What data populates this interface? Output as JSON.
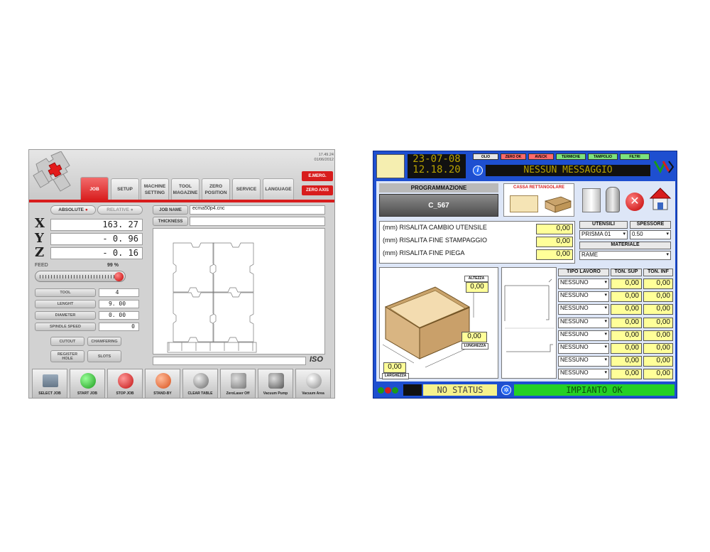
{
  "cnc": {
    "time": "17.49.24",
    "date": "01/06/2012",
    "tabs": [
      {
        "l1": "JOB",
        "l2": ""
      },
      {
        "l1": "SETUP",
        "l2": ""
      },
      {
        "l1": "MACHINE",
        "l2": "SETTING"
      },
      {
        "l1": "TOOL",
        "l2": "MAGAZINE"
      },
      {
        "l1": "ZERO",
        "l2": "POSITION"
      },
      {
        "l1": "SERVICE",
        "l2": ""
      },
      {
        "l1": "LANGUAGE",
        "l2": ""
      }
    ],
    "emerg": "E.MERG.",
    "zero_axis": "ZERO AXIS",
    "absolute": "ABSOLUTE",
    "relative": "RELATIVE",
    "x_label": "X",
    "y_label": "Y",
    "z_label": "Z",
    "x_value": "163. 27",
    "y_value": "- 0. 96",
    "z_value": "- 0. 16",
    "feed_label": "FEED",
    "feed_value": "99 %",
    "feed_level": 0.99,
    "tool_label": "TOOL",
    "tool_value": "4",
    "lenght_label": "LENGHT",
    "lenght_value": "9. 00",
    "diameter_label": "DIAMETER",
    "diameter_value": "0. 00",
    "spindle_label": "SPINDLE SPEED",
    "spindle_value": "0",
    "cutout": "CUTOUT",
    "chamfering": "CHAMFERING",
    "register_hole_1": "REGISTER",
    "register_hole_2": "HOLE",
    "slots": "SLOTS",
    "job_name_label": "JOB NAME",
    "job_name_value": "ecma50p4.cnc",
    "thickness_label": "THICKNESS",
    "iso": "ISO",
    "toolbar": [
      "SELECT JOB",
      "START JOB",
      "STOP JOB",
      "STAND-BY",
      "CLEAR TABLE",
      "ZeroLaser Off",
      "Vacuum Pump",
      "Vacuum Area"
    ]
  },
  "press": {
    "date": "23-07-08",
    "time": "12.18.20",
    "leds": [
      "OLIO",
      "ZERO OK",
      "AVECK",
      "TERMICHE",
      "TAMPOLIO",
      "FILTRI"
    ],
    "message": "NESSUN MESSAGGIO",
    "programmazione": "PROGRAMMAZIONE",
    "program_name": "C_567",
    "cassa": "CASSA RETTANGOLARE",
    "params": [
      {
        "label": "(mm) RISALITA CAMBIO UTENSILE",
        "value": "0,00"
      },
      {
        "label": "(mm) RISALITA FINE STAMPAGGIO",
        "value": "0,00"
      },
      {
        "label": "(mm) RISALITA FINE PIEGA",
        "value": "0,00"
      }
    ],
    "utensili_label": "UTENSILI",
    "utensili_value": "PRISMA 01",
    "spessore_label": "SPESSORE",
    "spessore_value": "0.50",
    "materiale_label": "MATERIALE",
    "materiale_value": "RAME",
    "altezza_label": "ALTEZZA",
    "altezza_value": "0,00",
    "lunghezza_label": "LUNGHEZZA",
    "lunghezza_value": "0,00",
    "larghezza_label": "LARGHEZZA",
    "larghezza_value": "0,00",
    "col_tipo": "TIPO LAVORO",
    "col_sup": "TON. SUP",
    "col_inf": "TON. INF",
    "rows": [
      {
        "tipo": "NESSUNO",
        "sup": "0,00",
        "inf": "0,00"
      },
      {
        "tipo": "NESSUNO",
        "sup": "0,00",
        "inf": "0,00"
      },
      {
        "tipo": "NESSUNO",
        "sup": "0,00",
        "inf": "0,00"
      },
      {
        "tipo": "NESSUNO",
        "sup": "0,00",
        "inf": "0,00"
      },
      {
        "tipo": "NESSUNO",
        "sup": "0,00",
        "inf": "0,00"
      },
      {
        "tipo": "NESSUNO",
        "sup": "0,00",
        "inf": "0,00"
      },
      {
        "tipo": "NESSUNO",
        "sup": "0,00",
        "inf": "0,00"
      },
      {
        "tipo": "NESSUNO",
        "sup": "0,00",
        "inf": "0,00"
      }
    ],
    "no_status": "NO STATUS",
    "impianto": "IMPIANTO OK"
  }
}
